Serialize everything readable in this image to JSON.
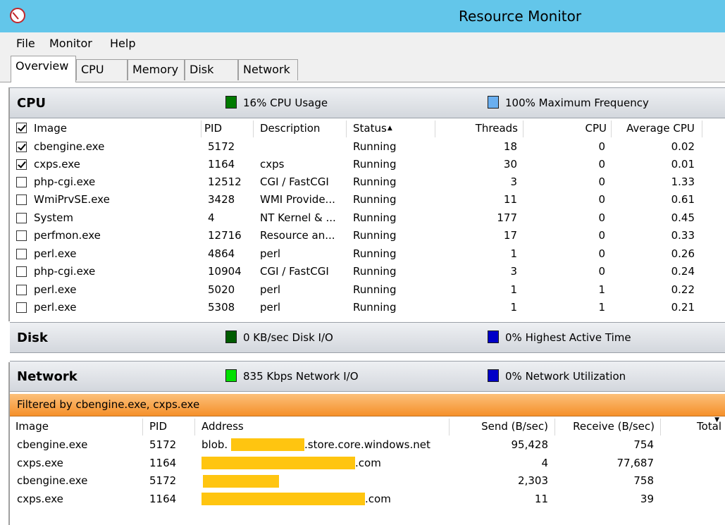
{
  "window": {
    "title": "Resource Monitor"
  },
  "menu": [
    "File",
    "Monitor",
    "Help"
  ],
  "tabs": [
    "Overview",
    "CPU",
    "Memory",
    "Disk",
    "Network"
  ],
  "colors": {
    "titlebar": "#63c6ea",
    "cpu_usage": "#007a00",
    "max_freq": "#6aaff0",
    "disk_io": "#005c00",
    "highest_active": "#0000c8",
    "network_io": "#00e000",
    "net_util": "#0000c8",
    "filter_bar": "#f5902a",
    "redaction": "#ffc510"
  },
  "cpu": {
    "title": "CPU",
    "usage": "16% CPU Usage",
    "freq": "100% Maximum Frequency",
    "columns": [
      "Image",
      "PID",
      "Description",
      "Status",
      "Threads",
      "CPU",
      "Average CPU"
    ],
    "rows": [
      {
        "checked": true,
        "image": "cbengine.exe",
        "pid": "5172",
        "desc": "",
        "status": "Running",
        "threads": "18",
        "cpu": "0",
        "avg": "0.02"
      },
      {
        "checked": true,
        "image": "cxps.exe",
        "pid": "1164",
        "desc": "cxps",
        "status": "Running",
        "threads": "30",
        "cpu": "0",
        "avg": "0.01"
      },
      {
        "checked": false,
        "image": "php-cgi.exe",
        "pid": "12512",
        "desc": "CGI / FastCGI",
        "status": "Running",
        "threads": "3",
        "cpu": "0",
        "avg": "1.33"
      },
      {
        "checked": false,
        "image": "WmiPrvSE.exe",
        "pid": "3428",
        "desc": "WMI Provide...",
        "status": "Running",
        "threads": "11",
        "cpu": "0",
        "avg": "0.61"
      },
      {
        "checked": false,
        "image": "System",
        "pid": "4",
        "desc": "NT Kernel & ...",
        "status": "Running",
        "threads": "177",
        "cpu": "0",
        "avg": "0.45"
      },
      {
        "checked": false,
        "image": "perfmon.exe",
        "pid": "12716",
        "desc": "Resource an...",
        "status": "Running",
        "threads": "17",
        "cpu": "0",
        "avg": "0.33"
      },
      {
        "checked": false,
        "image": "perl.exe",
        "pid": "4864",
        "desc": "perl",
        "status": "Running",
        "threads": "1",
        "cpu": "0",
        "avg": "0.26"
      },
      {
        "checked": false,
        "image": "php-cgi.exe",
        "pid": "10904",
        "desc": "CGI / FastCGI",
        "status": "Running",
        "threads": "3",
        "cpu": "0",
        "avg": "0.24"
      },
      {
        "checked": false,
        "image": "perl.exe",
        "pid": "5020",
        "desc": "perl",
        "status": "Running",
        "threads": "1",
        "cpu": "1",
        "avg": "0.22"
      },
      {
        "checked": false,
        "image": "perl.exe",
        "pid": "5308",
        "desc": "perl",
        "status": "Running",
        "threads": "1",
        "cpu": "1",
        "avg": "0.21"
      }
    ]
  },
  "disk": {
    "title": "Disk",
    "io": "0 KB/sec Disk I/O",
    "active": "0% Highest Active Time"
  },
  "network": {
    "title": "Network",
    "io": "835 Kbps Network I/O",
    "util": "0% Network Utilization",
    "filter": "Filtered by cbengine.exe, cxps.exe",
    "columns": [
      "Image",
      "PID",
      "Address",
      "Send (B/sec)",
      "Receive (B/sec)",
      "Total"
    ],
    "rows": [
      {
        "image": "cbengine.exe",
        "pid": "5172",
        "addr_pre": "blob.",
        "addr_post": ".store.core.windows.net",
        "send": "95,428",
        "recv": "754"
      },
      {
        "image": "cxps.exe",
        "pid": "1164",
        "addr_pre": "",
        "addr_post": ".com",
        "send": "4",
        "recv": "77,687"
      },
      {
        "image": "cbengine.exe",
        "pid": "5172",
        "addr_pre": "",
        "addr_post": "",
        "send": "2,303",
        "recv": "758"
      },
      {
        "image": "cxps.exe",
        "pid": "1164",
        "addr_pre": "",
        "addr_post": ".com",
        "send": "11",
        "recv": "39"
      }
    ]
  }
}
